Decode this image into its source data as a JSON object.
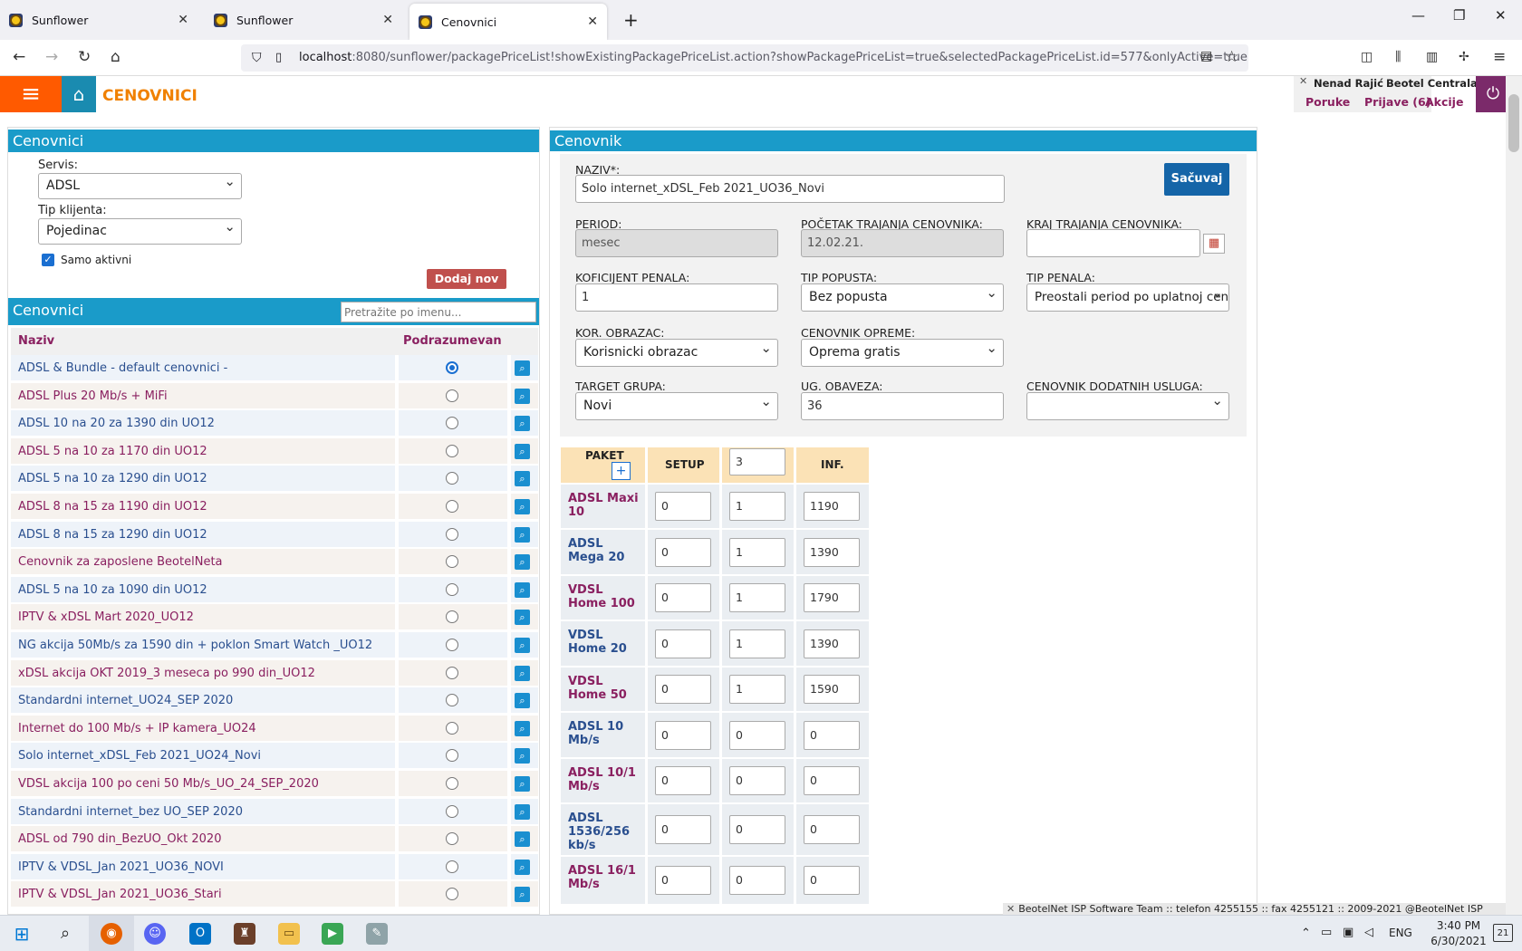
{
  "browser": {
    "tabs": [
      {
        "label": "Sunflower"
      },
      {
        "label": "Sunflower"
      },
      {
        "label": "Cenovnici"
      }
    ],
    "url": {
      "host": "localhost",
      "path": ":8080/sunflower/packagePriceList!showExistingPackagePriceList.action?showPackagePriceList=true&selectedPackagePriceList.id=577&onlyActive=true"
    }
  },
  "app": {
    "title": "CENOVNICI",
    "user": "Nenad Rajić",
    "org": "Beotel Centrala",
    "links": {
      "poruke": "Poruke",
      "prijave": "Prijave (6)",
      "akcije": "Akcije"
    }
  },
  "left": {
    "header": "Cenovnici",
    "servis_label": "Servis:",
    "servis_value": "ADSL",
    "tip_label": "Tip klijenta:",
    "tip_value": "Pojedinac",
    "samo_aktivni": "Samo aktivni",
    "add_button": "Dodaj nov",
    "list_header": "Cenovnici",
    "search_placeholder": "Pretražite po imenu...",
    "col_naziv": "Naziv",
    "col_podrazumevan": "Podrazumevan",
    "rows": [
      {
        "name": "ADSL & Bundle - default cenovnici -",
        "default": true
      },
      {
        "name": "ADSL Plus 20 Mb/s + MiFi",
        "default": false
      },
      {
        "name": "ADSL 10 na 20 za 1390 din UO12",
        "default": false
      },
      {
        "name": "ADSL 5 na 10 za 1170 din UO12",
        "default": false
      },
      {
        "name": "ADSL 5 na 10 za 1290 din UO12",
        "default": false
      },
      {
        "name": "ADSL 8 na 15 za 1190 din UO12",
        "default": false
      },
      {
        "name": "ADSL 8 na 15 za 1290 din UO12",
        "default": false
      },
      {
        "name": "Cenovnik za zaposlene BeotelNeta",
        "default": false
      },
      {
        "name": "ADSL 5 na 10 za 1090 din UO12",
        "default": false
      },
      {
        "name": "IPTV & xDSL Mart 2020_UO12",
        "default": false
      },
      {
        "name": "NG akcija 50Mb/s za 1590 din + poklon Smart Watch _UO12",
        "default": false
      },
      {
        "name": "xDSL akcija OKT 2019_3 meseca po 990 din_UO12",
        "default": false
      },
      {
        "name": "Standardni internet_UO24_SEP 2020",
        "default": false
      },
      {
        "name": "Internet do 100 Mb/s + IP kamera_UO24",
        "default": false
      },
      {
        "name": "Solo internet_xDSL_Feb 2021_UO24_Novi",
        "default": false
      },
      {
        "name": "VDSL akcija 100 po ceni 50 Mb/s_UO_24_SEP_2020",
        "default": false
      },
      {
        "name": "Standardni internet_bez UO_SEP 2020",
        "default": false
      },
      {
        "name": "ADSL od 790 din_BezUO_Okt 2020",
        "default": false
      },
      {
        "name": "IPTV & VDSL_Jan 2021_UO36_NOVI",
        "default": false
      },
      {
        "name": "IPTV & VDSL_Jan 2021_UO36_Stari",
        "default": false
      }
    ]
  },
  "right": {
    "header": "Cenovnik",
    "save": "Sačuvaj",
    "naziv_label": "NAZIV*:",
    "naziv_value": "Solo internet_xDSL_Feb 2021_UO36_Novi",
    "period_label": "PERIOD:",
    "period_value": "mesec",
    "pocetak_label": "POČETAK TRAJANJA CENOVNIKA:",
    "pocetak_value": "12.02.21.",
    "kraj_label": "KRAJ TRAJANJA CENOVNIKA:",
    "kraj_value": "",
    "kof_label": "KOFICIJENT PENALA:",
    "kof_value": "1",
    "tip_popusta_label": "TIP POPUSTA:",
    "tip_popusta_value": "Bez popusta",
    "tip_penala_label": "TIP PENALA:",
    "tip_penala_value": "Preostali period po uplatnoj ceni",
    "kor_label": "KOR. OBRAZAC:",
    "kor_value": "Korisnicki obrazac",
    "opreme_label": "CENOVNIK OPREME:",
    "opreme_value": "Oprema gratis",
    "target_label": "TARGET GRUPA:",
    "target_value": "Novi",
    "ug_label": "UG. OBAVEZA:",
    "ug_value": "36",
    "dodatnih_label": "CENOVNIK DODATNIH USLUGA:",
    "dodatnih_value": "",
    "pkg_head": {
      "paket": "PAKET",
      "setup": "SETUP",
      "period_input": "3",
      "inf": "INF."
    },
    "packages": [
      {
        "name": "ADSL Maxi 10",
        "setup": "0",
        "n": "1",
        "inf": "1190"
      },
      {
        "name": "ADSL Mega 20",
        "setup": "0",
        "n": "1",
        "inf": "1390"
      },
      {
        "name": "VDSL Home 100",
        "setup": "0",
        "n": "1",
        "inf": "1790"
      },
      {
        "name": "VDSL Home 20",
        "setup": "0",
        "n": "1",
        "inf": "1390"
      },
      {
        "name": "VDSL Home 50",
        "setup": "0",
        "n": "1",
        "inf": "1590"
      },
      {
        "name": "ADSL 10 Mb/s",
        "setup": "0",
        "n": "0",
        "inf": "0"
      },
      {
        "name": "ADSL 10/1 Mb/s",
        "setup": "0",
        "n": "0",
        "inf": "0"
      },
      {
        "name": "ADSL 1536/256 kb/s",
        "setup": "0",
        "n": "0",
        "inf": "0"
      },
      {
        "name": "ADSL 16/1 Mb/s",
        "setup": "0",
        "n": "0",
        "inf": "0"
      }
    ]
  },
  "footer": {
    "text": "BeotelNet ISP Software Team :: telefon 4255155 :: fax 4255121 :: 2009-2021 @BeotelNet ISP"
  },
  "taskbar": {
    "lang": "ENG",
    "time": "3:40 PM",
    "date": "6/30/2021",
    "notif": "21"
  }
}
